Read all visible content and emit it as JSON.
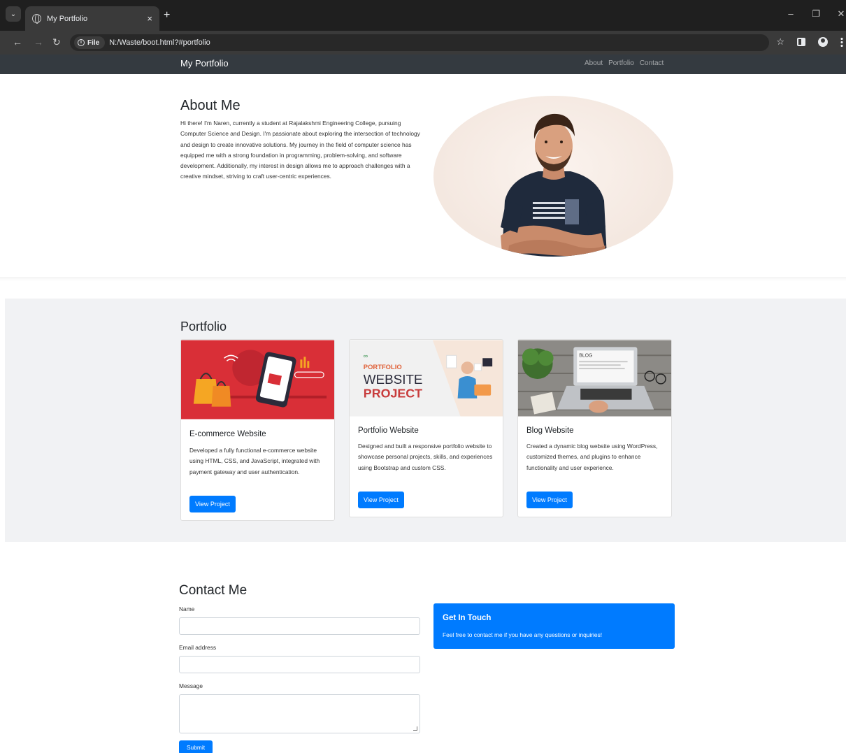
{
  "browser": {
    "tab_title": "My Portfolio",
    "tab_close": "×",
    "new_tab": "+",
    "url_chip": "File",
    "url": "N:/Waste/boot.html?#portfolio",
    "icons": [
      "tab-search-icon",
      "globe-icon",
      "back-icon",
      "forward-icon",
      "reload-icon",
      "info-icon",
      "star-icon",
      "side-panel-icon",
      "profile-icon",
      "kebab-menu-icon",
      "minimize-icon",
      "restore-icon",
      "close-icon"
    ]
  },
  "navbar": {
    "brand": "My Portfolio",
    "links": [
      "About",
      "Portfolio",
      "Contact"
    ]
  },
  "about": {
    "heading": "About Me",
    "text": "Hi there! I'm Naren, currently a student at Rajalakshmi Engineering College, pursuing Computer Science and Design. I'm passionate about exploring the intersection of technology and design to create innovative solutions. My journey in the field of computer science has equipped me with a strong foundation in programming, problem-solving, and software development. Additionally, my interest in design allows me to approach challenges with a creative mindset, striving to craft user-centric experiences."
  },
  "portfolio": {
    "heading": "Portfolio",
    "cards": [
      {
        "title": "E-commerce Website",
        "text": "Developed a fully functional e-commerce website using HTML, CSS, and JavaScript, integrated with payment gateway and user authentication.",
        "button": "View Project"
      },
      {
        "title": "Portfolio Website",
        "text": "Designed and built a responsive portfolio website to showcase personal projects, skills, and experiences using Bootstrap and custom CSS.",
        "button": "View Project",
        "thumb_lines": [
          "PORTFOLIO",
          "WEBSITE",
          "PROJECT"
        ]
      },
      {
        "title": "Blog Website",
        "text": "Created a dynamic blog website using WordPress, customized themes, and plugins to enhance functionality and user experience.",
        "button": "View Project",
        "thumb_text": "BLOG"
      }
    ]
  },
  "contact": {
    "heading": "Contact Me",
    "name_label": "Name",
    "email_label": "Email address",
    "message_label": "Message",
    "submit": "Submit",
    "card_title": "Get In Touch",
    "card_text": "Feel free to contact me if you have any questions or inquiries!"
  },
  "colors": {
    "primary": "#007bff",
    "navbar": "#343a40",
    "section_bg": "#f1f2f4",
    "ecommerce_red": "#d92f37"
  }
}
